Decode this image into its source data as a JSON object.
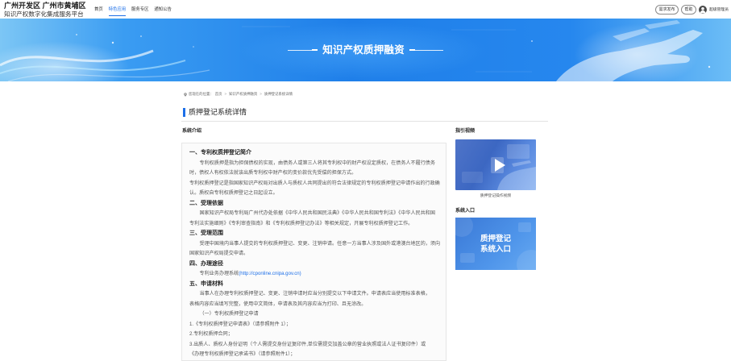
{
  "header": {
    "logo_line1": "广州开发区 广州市黄埔区",
    "logo_line2": "知识产权数字化集成服务平台",
    "nav": [
      {
        "label": "首页"
      },
      {
        "label": "特色应用",
        "active": true
      },
      {
        "label": "服务专区"
      },
      {
        "label": "通知公告"
      }
    ],
    "publish_button": "需求发布",
    "help_button": "帮助",
    "user_name": "超级管理员"
  },
  "banner": {
    "title": "知识产权质押融资"
  },
  "breadcrumb": {
    "prefix": "您现在的位置：",
    "separator": ">",
    "items": [
      "首页",
      "知识产权质押融资",
      "质押登记系统详情"
    ]
  },
  "page": {
    "title": "质押登记系统详情"
  },
  "intro": {
    "label": "系统介绍",
    "sections": [
      {
        "heading": "一、专利权质押登记简介",
        "lines": [
          "专利权质押是指为担保债权的实现，由债务人或第三人将其专利权中的财产权设定质权，在债务人不履行债务",
          "时，债权人有权依法就该出质专利权中财产权的变价款优先受偿的担保方式。",
          "专利权质押登记是指国家知识产权局对出质人与质权人共同提出的符合法律规定的专利权质押登记申请作出的行政确",
          "认。质权自专利权质押登记之日起设立。"
        ]
      },
      {
        "heading": "二、受理依据",
        "lines": [
          "国家知识产权局专利局广州代办处依据《中华人民共和国民法典》《中华人民共和国专利法》《中华人民共和国",
          "专利法实施细则》《专利审查指南》和《专利权质押登记办法》等相关规定，开展专利权质押登记工作。"
        ]
      },
      {
        "heading": "三、受理范围",
        "lines": [
          "受理中国境内当事人提交的专利权质押登记、变更、注销申请。任意一方当事人涉及国外或港澳台地区的，须向",
          "国家知识产权局提交申请。"
        ]
      },
      {
        "heading": "四、办理途径",
        "text": "专利业务办理系统",
        "link": "(http://cponline.cnipa.gov.cn)"
      },
      {
        "heading": "五、申请材料",
        "lines": [
          "当事人在办理专利权质押登记、变更、注销申请时应当分别提交以下申请文件。申请表应当使用标准表格，",
          "表格内容应当填写完整，使用中文简体，申请表及其内容应当为打印、且无涂改。",
          "（一）专利权质押登记申请",
          "1.《专利权质押登记申请表》（请参照附件 1）；",
          "2.专利权质押合同；",
          "3.出质人、质权人身份证明（个人需提交身份证复印件,单位需提交加盖公章的营业执照或法人证书复印件）或",
          "《办理专利权质押登记承诺书》（请参照附件1）；"
        ]
      }
    ]
  },
  "sidebar": {
    "video_heading": "指引视频",
    "video_caption": "质押登记操作视频",
    "entry_heading": "系统入口",
    "entry_line1": "质押登记",
    "entry_line2": "系统入口"
  },
  "icons": {
    "avatar": "user-avatar-icon",
    "breadcrumb": "location-pin-icon",
    "video": "play-icon"
  },
  "colors": {
    "accent": "#1d6fe8",
    "link": "#1d6fe8"
  }
}
